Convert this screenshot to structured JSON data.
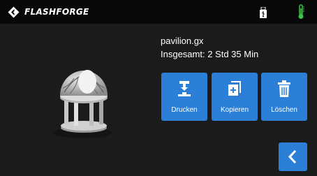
{
  "header": {
    "brand": "FLASHFORGE",
    "icons": [
      "flashforge-logo-icon",
      "usb-drive-icon",
      "temperature-icon"
    ],
    "brand_color": "#ffffff",
    "status_color": "#3cc24a"
  },
  "file": {
    "name": "pavilion.gx",
    "total_time": "Insgesamt: 2 Std 35 Min"
  },
  "actions": {
    "print_label": "Drucken",
    "copy_label": "Kopieren",
    "delete_label": "Löschen"
  },
  "accent_color": "#2b7fd6",
  "icons": [
    "printer-nozzle-icon",
    "copy-icon",
    "trash-icon",
    "chevron-left-icon"
  ]
}
